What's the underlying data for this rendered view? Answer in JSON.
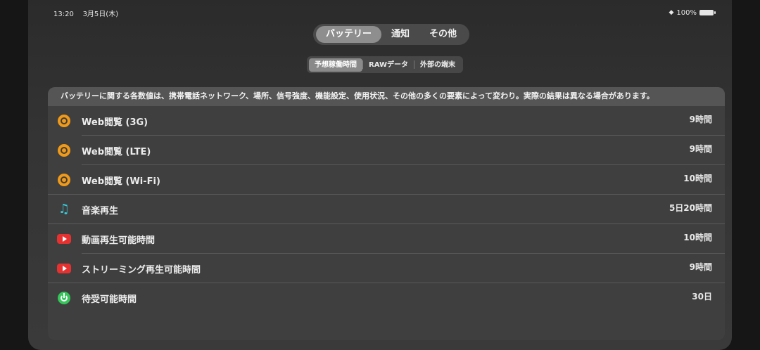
{
  "status_bar": {
    "time": "13:20",
    "date": "3月5日(木)",
    "battery": "100%"
  },
  "main_tabs": [
    {
      "label": "バッテリー",
      "active": true
    },
    {
      "label": "通知",
      "active": false
    },
    {
      "label": "その他",
      "active": false
    }
  ],
  "sub_tabs": [
    {
      "label": "予想稼働時間",
      "active": true
    },
    {
      "label": "RAWデータ",
      "active": false
    },
    {
      "label": "外部の端末",
      "active": false
    }
  ],
  "notice": "バッテリーに関する各数値は、携帯電話ネットワーク、場所、信号強度、機能設定、使用状況、その他の多くの要素によって変わり。実際の結果は異なる場合があります。",
  "rows": [
    {
      "icon": "compass-icon",
      "label": "Web閲覧 (3G)",
      "value": "9時間"
    },
    {
      "icon": "compass-icon",
      "label": "Web閲覧 (LTE)",
      "value": "9時間"
    },
    {
      "icon": "compass-icon",
      "label": "Web閲覧 (Wi-Fi)",
      "value": "10時間"
    },
    {
      "icon": "music-note-icon",
      "label": "音楽再生",
      "value": "5日20時間"
    },
    {
      "icon": "video-play-icon",
      "label": "動画再生可能時間",
      "value": "10時間"
    },
    {
      "icon": "video-play-icon",
      "label": "ストリーミング再生可能時間",
      "value": "9時間"
    },
    {
      "icon": "power-icon",
      "label": "待受可能時間",
      "value": "30日"
    }
  ],
  "colors": {
    "compass": "#f19a18",
    "music": "#35d0e0",
    "video": "#e63131",
    "power": "#34c759"
  }
}
